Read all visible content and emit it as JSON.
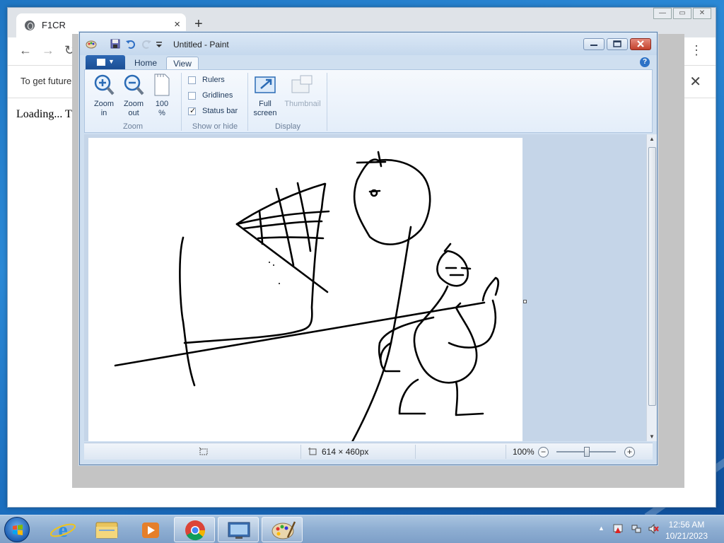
{
  "browser": {
    "tab_title": "F1CR",
    "new_tab_symbol": "+",
    "tab_close": "×",
    "infobar_message": "To get future",
    "infobar_close": "✕",
    "page_text": "Loading... T",
    "menu_symbol": "⋮"
  },
  "paint": {
    "window_title": "Untitled - Paint",
    "tabs": {
      "home": "Home",
      "view": "View"
    },
    "help": "?",
    "zoom_group": {
      "label": "Zoom",
      "zoom_in": [
        "Zoom",
        "in"
      ],
      "zoom_out": [
        "Zoom",
        "out"
      ],
      "hundred": [
        "100",
        "%"
      ]
    },
    "show_hide_group": {
      "label": "Show or hide",
      "rulers": {
        "label": "Rulers",
        "checked": false
      },
      "gridlines": {
        "label": "Gridlines",
        "checked": false
      },
      "status_bar": {
        "label": "Status bar",
        "checked": true
      }
    },
    "display_group": {
      "label": "Display",
      "full_screen": [
        "Full",
        "screen"
      ],
      "thumbnail": "Thumbnail"
    },
    "status": {
      "canvas_size": "614 × 460px",
      "zoom_level": "100%",
      "zoom_out_symbol": "−",
      "zoom_in_symbol": "+"
    }
  },
  "taskbar": {
    "time": "12:56 AM",
    "date": "10/21/2023",
    "show_hidden": "▲"
  },
  "colors": {
    "accent": "#1b4e94",
    "desktop": "#1f76c3"
  }
}
